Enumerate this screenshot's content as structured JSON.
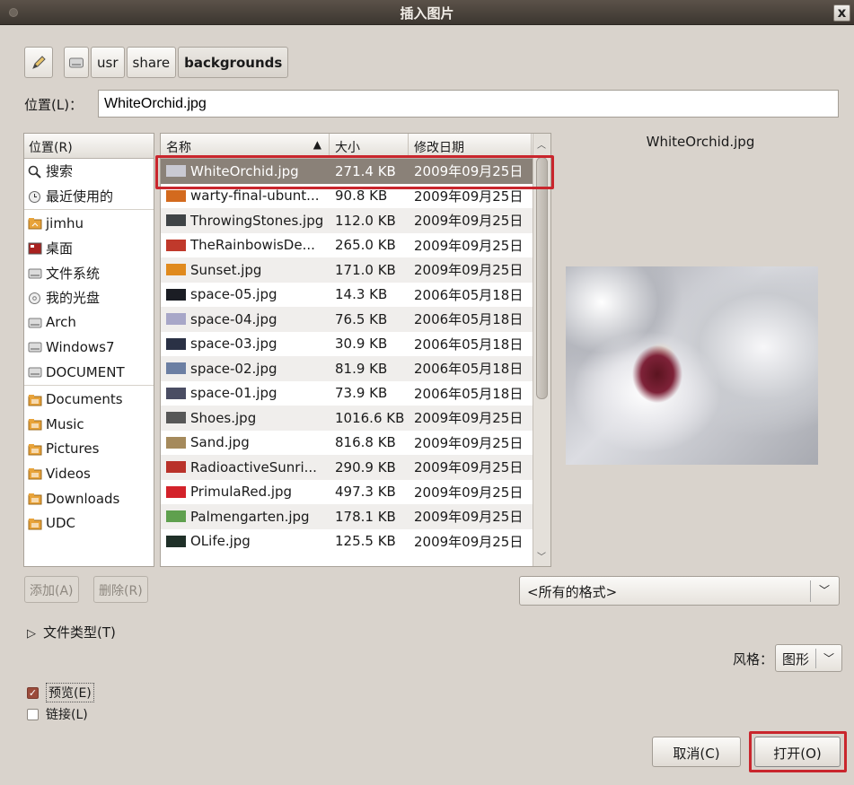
{
  "window": {
    "title": "插入图片",
    "close_glyph": "x"
  },
  "pathbar": {
    "segments": [
      "usr",
      "share",
      "backgrounds"
    ]
  },
  "location": {
    "label": "位置(L)：",
    "value": "WhiteOrchid.jpg"
  },
  "places": {
    "header": "位置(R)",
    "items": [
      {
        "label": "搜索",
        "icon": "search-icon"
      },
      {
        "label": "最近使用的",
        "icon": "clock-icon"
      },
      {
        "label": "jimhu",
        "icon": "home-folder-icon"
      },
      {
        "label": "桌面",
        "icon": "desktop-icon"
      },
      {
        "label": "文件系统",
        "icon": "drive-icon"
      },
      {
        "label": "我的光盘",
        "icon": "disc-icon"
      },
      {
        "label": "Arch",
        "icon": "drive-icon"
      },
      {
        "label": "Windows7",
        "icon": "drive-icon"
      },
      {
        "label": "DOCUMENT",
        "icon": "drive-icon"
      },
      {
        "label": "Documents",
        "icon": "folder-icon"
      },
      {
        "label": "Music",
        "icon": "folder-icon"
      },
      {
        "label": "Pictures",
        "icon": "folder-icon"
      },
      {
        "label": "Videos",
        "icon": "folder-icon"
      },
      {
        "label": "Downloads",
        "icon": "folder-icon"
      },
      {
        "label": "UDC",
        "icon": "folder-icon"
      }
    ]
  },
  "files": {
    "columns": [
      "名称",
      "大小",
      "修改日期"
    ],
    "rows": [
      {
        "name": "WhiteOrchid.jpg",
        "size": "271.4 KB",
        "date": "2009年09月25日",
        "color": "#c9c9d2"
      },
      {
        "name": "warty-final-ubunt...",
        "size": "90.8 KB",
        "date": "2009年09月25日",
        "color": "#d36a1e"
      },
      {
        "name": "ThrowingStones.jpg",
        "size": "112.0 KB",
        "date": "2009年09月25日",
        "color": "#404447"
      },
      {
        "name": "TheRainbowisDe...",
        "size": "265.0 KB",
        "date": "2009年09月25日",
        "color": "#c0392b"
      },
      {
        "name": "Sunset.jpg",
        "size": "171.0 KB",
        "date": "2009年09月25日",
        "color": "#e08a1e"
      },
      {
        "name": "space-05.jpg",
        "size": "14.3 KB",
        "date": "2006年05月18日",
        "color": "#1b1d24"
      },
      {
        "name": "space-04.jpg",
        "size": "76.5 KB",
        "date": "2006年05月18日",
        "color": "#a8a7c8"
      },
      {
        "name": "space-03.jpg",
        "size": "30.9 KB",
        "date": "2006年05月18日",
        "color": "#2a3145"
      },
      {
        "name": "space-02.jpg",
        "size": "81.9 KB",
        "date": "2006年05月18日",
        "color": "#6c7fa3"
      },
      {
        "name": "space-01.jpg",
        "size": "73.9 KB",
        "date": "2006年05月18日",
        "color": "#4a4d63"
      },
      {
        "name": "Shoes.jpg",
        "size": "1016.6 KB",
        "date": "2009年09月25日",
        "color": "#575757"
      },
      {
        "name": "Sand.jpg",
        "size": "816.8 KB",
        "date": "2009年09月25日",
        "color": "#a58a5c"
      },
      {
        "name": "RadioactiveSunri...",
        "size": "290.9 KB",
        "date": "2009年09月25日",
        "color": "#b9322a"
      },
      {
        "name": "PrimulaRed.jpg",
        "size": "497.3 KB",
        "date": "2009年09月25日",
        "color": "#d3222a"
      },
      {
        "name": "Palmengarten.jpg",
        "size": "178.1 KB",
        "date": "2009年09月25日",
        "color": "#5fa04e"
      },
      {
        "name": "OLife.jpg",
        "size": "125.5 KB",
        "date": "2009年09月25日",
        "color": "#1f3028"
      }
    ]
  },
  "preview": {
    "filename": "WhiteOrchid.jpg"
  },
  "buttons": {
    "add": "添加(A)",
    "remove": "删除(R)",
    "cancel": "取消(C)",
    "open": "打开(O)"
  },
  "filter": {
    "value": "<所有的格式>"
  },
  "file_type_expander": "文件类型(T)",
  "style": {
    "label": "风格：",
    "value": "图形"
  },
  "checkboxes": {
    "preview": "预览(E)",
    "link": "链接(L)"
  },
  "accent": "#c9262d"
}
